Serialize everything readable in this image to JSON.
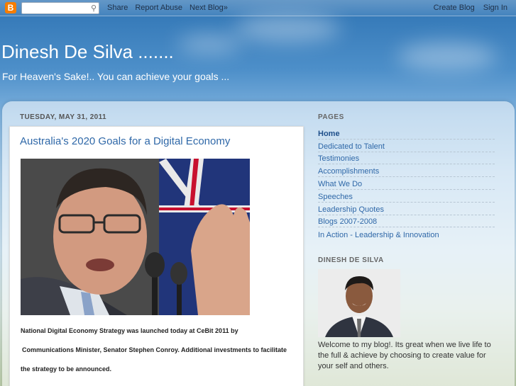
{
  "navbar": {
    "logo": "B",
    "search_placeholder": "",
    "share": "Share",
    "report_abuse": "Report Abuse",
    "next_blog": "Next Blog»",
    "create_blog": "Create Blog",
    "sign_in": "Sign In"
  },
  "header": {
    "title": "Dinesh De Silva .......",
    "description": "For Heaven's Sake!.. You can achieve your goals ..."
  },
  "post": {
    "date": "TUESDAY, MAY 31, 2011",
    "title": "Australia's 2020 Goals for a Digital Economy",
    "paragraphs": [
      "National Digital Economy Strategy was launched today at CeBit 2011 by",
      "Communications Minister, Senator Stephen Conroy. Additional investments to facilitate",
      "the strategy to be announced."
    ]
  },
  "sidebar": {
    "pages_title": "PAGES",
    "pages": [
      "Home",
      "Dedicated to Talent",
      "Testimonies",
      "Accomplishments",
      "What We Do",
      "Speeches",
      "Leadership Quotes",
      "Blogs 2007-2008",
      "In Action - Leadership & Innovation"
    ],
    "profile_title": "DINESH DE SILVA",
    "profile_text": "Welcome to my blog!. Its great when we live life to the full & achieve by choosing to create value for your self and others."
  },
  "colors": {
    "link": "#2f68a8",
    "blogger_orange": "#f57d00"
  }
}
